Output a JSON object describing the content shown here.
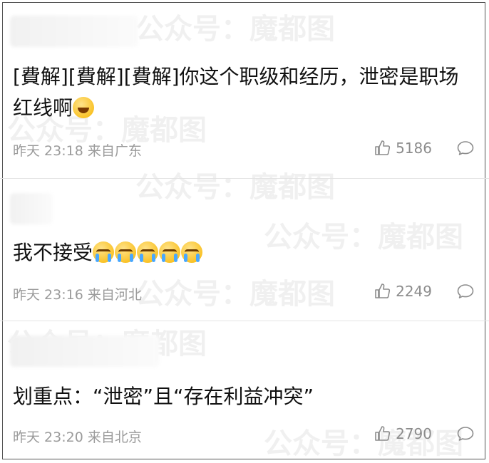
{
  "watermark": "公众号：魔都图",
  "comments": [
    {
      "text": "[費解][費解][費解]你这个职级和经历，泄密是职场红线啊",
      "emoji": "laugh-tears",
      "time": "昨天 23:18 来自广东",
      "likes": "5186"
    },
    {
      "text": "我不接受",
      "emoji": "crying x5",
      "time": "昨天 23:16 来自河北",
      "likes": "2249"
    },
    {
      "text": "划重点：“泄密”且“存在利益冲突”",
      "time": "昨天 23:20 来自北京",
      "likes": "2790"
    }
  ],
  "colors": {
    "meta": "#9b9b9b",
    "divider": "#e3e3e3"
  }
}
